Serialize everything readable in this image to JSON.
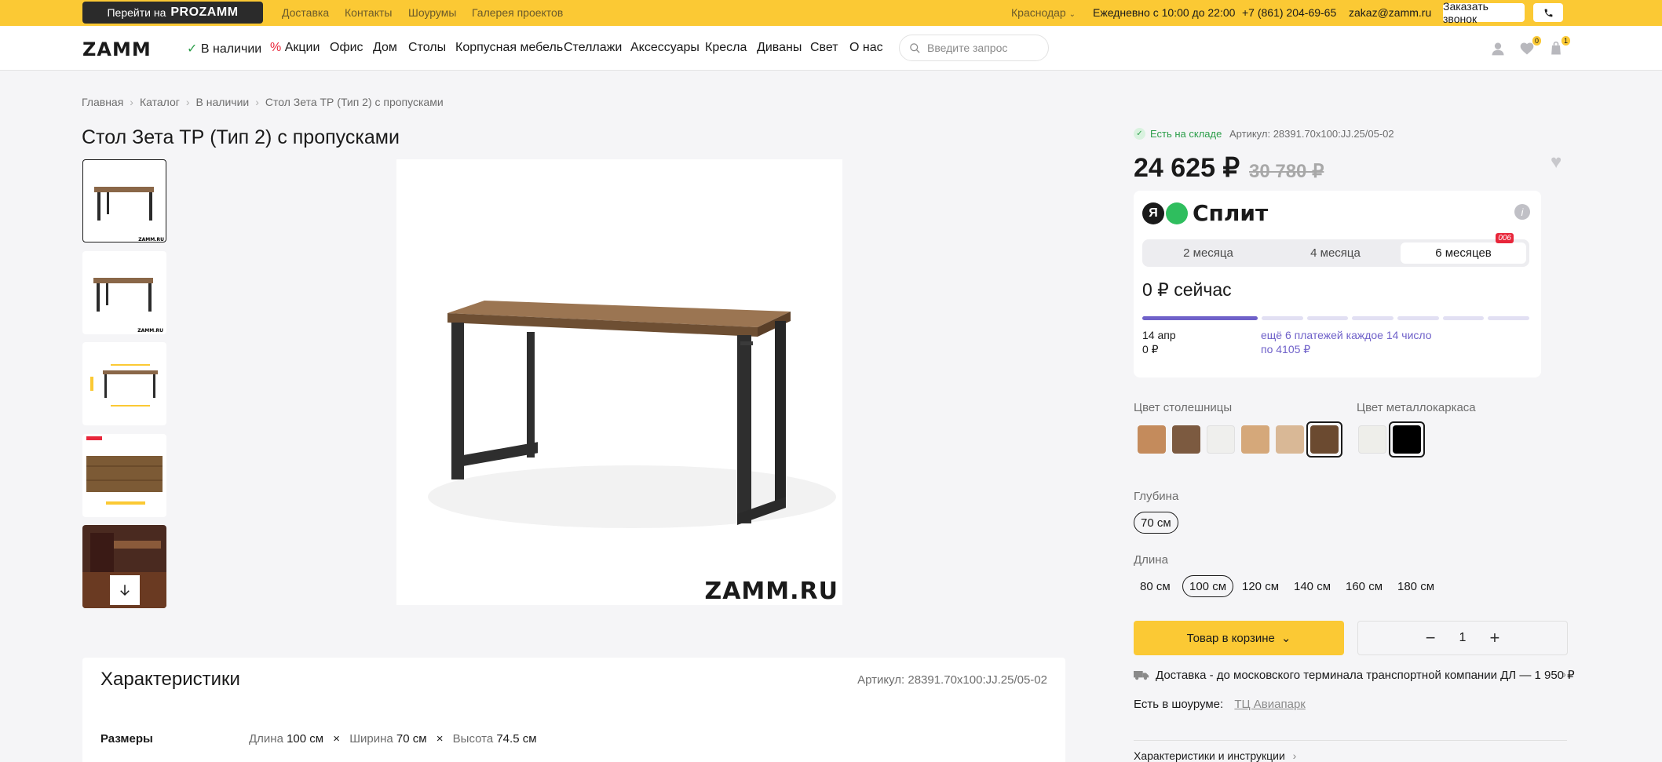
{
  "topbar": {
    "pro_prefix": "Перейти на",
    "pro_brand": "PROZAMM",
    "links": [
      "Доставка",
      "Контакты",
      "Шоурумы",
      "Галерея проектов"
    ],
    "city": "Краснодар",
    "hours": "Ежедневно с 10:00 до 22:00",
    "phone": "+7 (861) 204-69-65",
    "email": "zakaz@zamm.ru",
    "call_button": "Заказать звонок"
  },
  "nav": {
    "logo": "ZAMM",
    "items": [
      "В наличии",
      "Акции",
      "Офис",
      "Дом",
      "Столы",
      "Корпусная мебель",
      "Стеллажи",
      "Аксессуары",
      "Кресла",
      "Диваны",
      "Свет",
      "О нас"
    ],
    "search_placeholder": "Введите запрос",
    "fav_count": "0",
    "cart_count": "1"
  },
  "breadcrumbs": [
    "Главная",
    "Каталог",
    "В наличии",
    "Стол Зета ТР (Тип 2) с пропусками"
  ],
  "product": {
    "title": "Стол Зета ТР (Тип 2) с пропусками",
    "image_brand": "ZAMM.RU",
    "stock": "Есть на складе",
    "article": "Артикул: 28391.70x100:JJ.25/05-02",
    "price": "24 625 ₽",
    "old_price": "30 780 ₽"
  },
  "split": {
    "ya": "Я",
    "name": "Сплит",
    "tabs": [
      "2 месяца",
      "4 месяца",
      "6 месяцев"
    ],
    "selected_tab": 2,
    "promo": "006",
    "now": "0 ₽ сейчас",
    "first_date": "14 апр",
    "first_amount": "0 ₽",
    "rest_text": "ещё 6 платежей каждое 14 число",
    "rest_amount": "по 4105 ₽",
    "paid_segments": 1,
    "total_segments": 7
  },
  "options": {
    "top_color_label": "Цвет столешницы",
    "frame_color_label": "Цвет металлокаркаса",
    "top_colors": [
      "#c48b5c",
      "#7c5a40",
      "#efefed",
      "#d5a87a",
      "#d9b896",
      "#6b4a30"
    ],
    "top_selected": 5,
    "frame_colors": [
      "#eeeeea",
      "#000000"
    ],
    "frame_selected": 1,
    "depth_label": "Глубина",
    "depths": [
      "70 см"
    ],
    "depth_selected": 0,
    "length_label": "Длина",
    "lengths": [
      "80 см",
      "100 см",
      "120 см",
      "140 см",
      "160 см",
      "180 см"
    ],
    "length_selected": 1
  },
  "actions": {
    "cart_button": "Товар в корзине",
    "quantity": "1",
    "delivery": "Доставка - до московского терминала транспортной компании ДЛ — 1 950 ₽",
    "showroom_label": "Есть в шоуруме:",
    "showroom_link": "ТЦ Авиапарк",
    "instructions": "Характеристики и инструкции"
  },
  "characteristics": {
    "title": "Характеристики",
    "article": "Артикул: 28391.70x100:JJ.25/05-02",
    "dims_label": "Размеры",
    "length_label": "Длина",
    "length": "100 см",
    "width_label": "Ширина",
    "width": "70 см",
    "height_label": "Высота",
    "height": "74.5 см"
  }
}
